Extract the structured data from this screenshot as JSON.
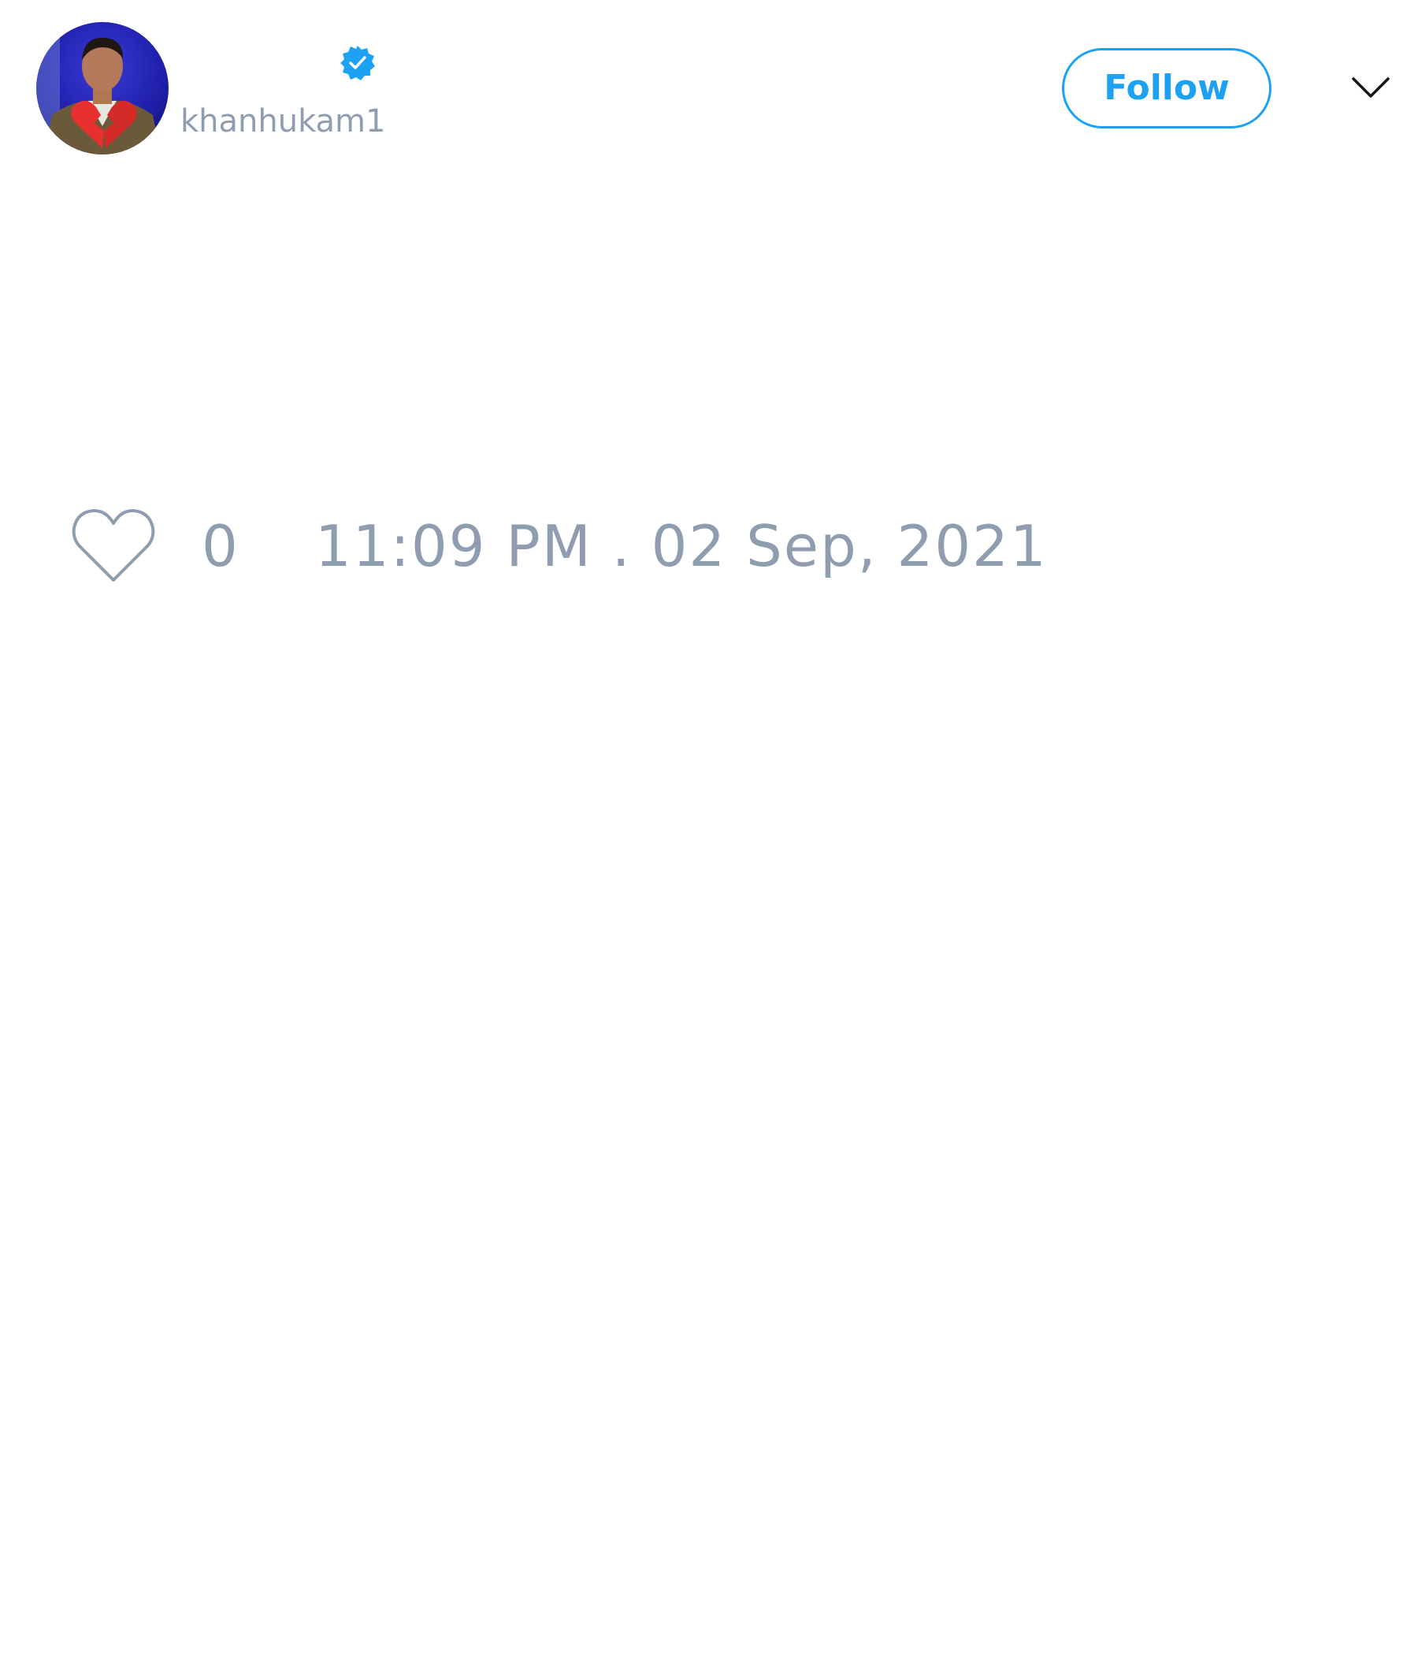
{
  "tweet": {
    "author": {
      "display_name": "",
      "handle": "khanhukam1",
      "verified_icon": "verified-badge-icon",
      "avatar": "avatar-photo"
    },
    "follow_label": "Follow",
    "menu_icon": "chevron-down-icon",
    "like_icon": "heart-outline-icon",
    "like_count": "0",
    "timestamp": "11:09 PM . 02 Sep, 2021"
  },
  "colors": {
    "accent": "#1da1f2",
    "muted_text": "#8f9db0",
    "background": "#ffffff"
  }
}
